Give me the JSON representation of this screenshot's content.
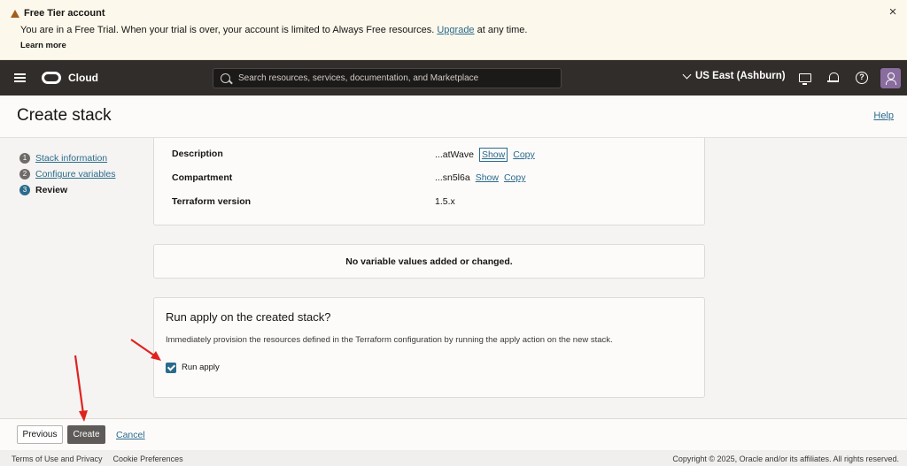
{
  "banner": {
    "title": "Free Tier account",
    "message_before": "You are in a Free Trial. When your trial is over, your account is limited to Always Free resources.",
    "upgrade_link": "Upgrade",
    "message_after": "at any time.",
    "learn_more": "Learn more",
    "close": "×"
  },
  "navbar": {
    "brand": "Cloud",
    "search_placeholder": "Search resources, services, documentation, and Marketplace",
    "region": "US East (Ashburn)",
    "help_glyph": "?"
  },
  "header": {
    "title": "Create stack",
    "help": "Help"
  },
  "steps": [
    {
      "num": "1",
      "label": "Stack information"
    },
    {
      "num": "2",
      "label": "Configure variables"
    },
    {
      "num": "3",
      "label": "Review"
    }
  ],
  "details": {
    "description_label": "Description",
    "description_value": "...atWave",
    "compartment_label": "Compartment",
    "compartment_value": "...sn5l6a",
    "terraform_label": "Terraform version",
    "terraform_value": "1.5.x",
    "show": "Show",
    "copy": "Copy"
  },
  "variables": {
    "message": "No variable values added or changed."
  },
  "apply": {
    "title": "Run apply on the created stack?",
    "description": "Immediately provision the resources defined in the Terraform configuration by running the apply action on the new stack.",
    "checkbox_label": "Run apply",
    "checked": true
  },
  "actions": {
    "previous": "Previous",
    "create": "Create",
    "cancel": "Cancel"
  },
  "footer": {
    "terms": "Terms of Use and Privacy",
    "cookies": "Cookie Preferences",
    "copyright": "Copyright © 2025, Oracle and/or its affiliates. All rights reserved."
  },
  "colors": {
    "accent": "#2b6b8c",
    "navbar": "#312d2a",
    "annotation_arrow": "#e0221f"
  }
}
